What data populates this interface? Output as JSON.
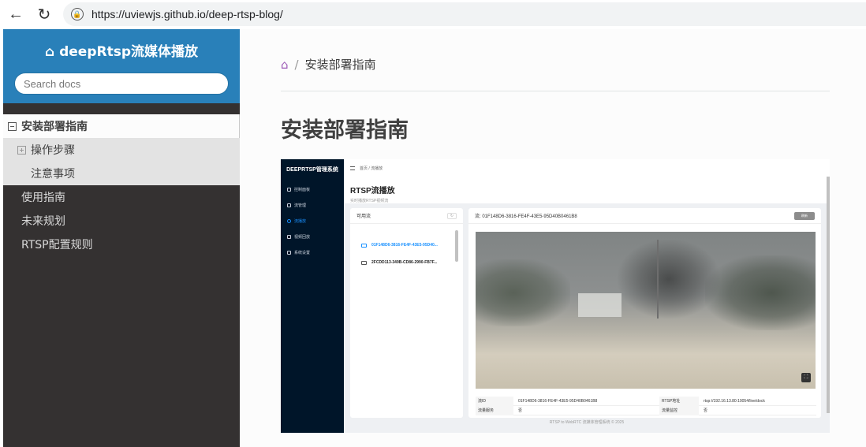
{
  "browser": {
    "url": "https://uviewjs.github.io/deep-rtsp-blog/"
  },
  "sidebar": {
    "brand": "deepRtsp流媒体播放",
    "search_placeholder": "Search docs",
    "items": [
      {
        "label": "安装部署指南",
        "state": "current"
      },
      {
        "label": "操作步骤",
        "state": "sub-collapsed"
      },
      {
        "label": "注意事项",
        "state": "sub"
      },
      {
        "label": "使用指南",
        "state": "plain"
      },
      {
        "label": "未来规划",
        "state": "plain"
      },
      {
        "label": "RTSP配置规则",
        "state": "plain"
      }
    ]
  },
  "main": {
    "breadcrumb": "安装部署指南",
    "title": "安装部署指南",
    "home_icon_color": "#9b59b6"
  },
  "screenshot": {
    "app_title": "DEEPRTSP管理系统",
    "menu": [
      "控制面板",
      "流管理",
      "流播放",
      "视频回放",
      "系统设置"
    ],
    "active_menu": "流播放",
    "top_breadcrumb": "首页 / 流播放",
    "page_title": "RTSP流播放",
    "page_subtitle": "实时播放RTSP视频流",
    "list_title": "可用流",
    "streams": [
      "01F148D6-3816-FE4F-43E5-95D40...",
      "2FCDD113-349B-CD86-2990-FB7F..."
    ],
    "player_header": "流: 01F148D6-3816-FE4F-43E5-95D40B0461B8",
    "refresh_button": "刷新",
    "info": {
      "stream_id_label": "流ID",
      "stream_id_value": "01F148D6-3816-FE4F-43E5-95D40B0461B8",
      "rtsp_label": "RTSP地址",
      "rtsp_value": "rtsp://192.16.13.80:10054/live/dock",
      "row2_label": "流量服务",
      "row2_value": "否",
      "row2b_label": "流量监控",
      "row2b_value": "否"
    },
    "footer": "RTSP to WebRTC 流媒体管理系统 © 2025"
  }
}
